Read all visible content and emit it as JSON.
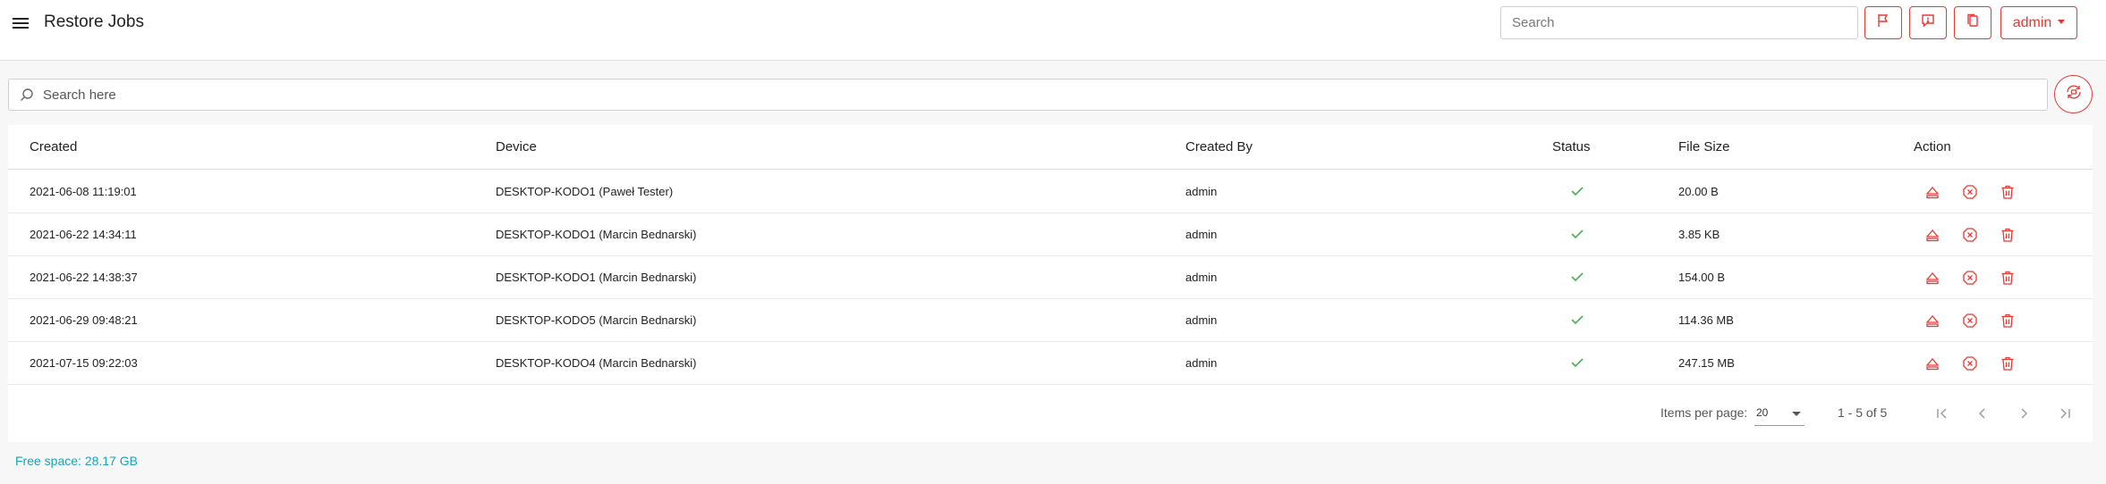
{
  "header": {
    "title": "Restore Jobs",
    "search_placeholder": "Search",
    "user_label": "admin",
    "icons": [
      "menu-icon",
      "flag-icon",
      "feedback-icon",
      "copy-icon"
    ]
  },
  "filter": {
    "placeholder": "Search here"
  },
  "table": {
    "columns": [
      "Created",
      "Device",
      "Created By",
      "Status",
      "File Size",
      "Action"
    ],
    "rows": [
      {
        "created": "2021-06-08 11:19:01",
        "device": "DESKTOP-KODO1 (Paweł Tester)",
        "created_by": "admin",
        "status": "completed",
        "file_size": "20.00 B"
      },
      {
        "created": "2021-06-22 14:34:11",
        "device": "DESKTOP-KODO1 (Marcin Bednarski)",
        "created_by": "admin",
        "status": "completed",
        "file_size": "3.85 KB"
      },
      {
        "created": "2021-06-22 14:38:37",
        "device": "DESKTOP-KODO1 (Marcin Bednarski)",
        "created_by": "admin",
        "status": "completed",
        "file_size": "154.00 B"
      },
      {
        "created": "2021-06-29 09:48:21",
        "device": "DESKTOP-KODO5 (Marcin Bednarski)",
        "created_by": "admin",
        "status": "completed",
        "file_size": "114.36 MB"
      },
      {
        "created": "2021-07-15 09:22:03",
        "device": "DESKTOP-KODO4 (Marcin Bednarski)",
        "created_by": "admin",
        "status": "completed",
        "file_size": "247.15 MB"
      }
    ],
    "row_actions": [
      "eject-icon",
      "cancel-icon",
      "delete-icon"
    ]
  },
  "pagination": {
    "items_per_page_label": "Items per page:",
    "items_per_page": "20",
    "range": "1 - 5 of 5"
  },
  "footer": {
    "free_space": "Free space: 28.17 GB"
  },
  "colors": {
    "accent": "#e53935",
    "success": "#4caf50",
    "info": "#1aa3b5"
  }
}
